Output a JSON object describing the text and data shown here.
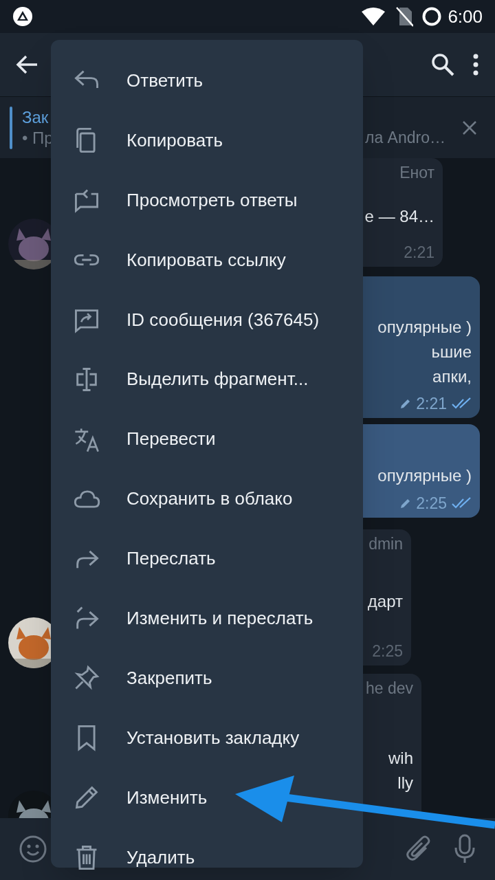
{
  "status_bar": {
    "time": "6:00"
  },
  "pinned": {
    "title": "Зак",
    "preview_start": "• Пр",
    "preview_end": "ла Andro…"
  },
  "messages": [
    {
      "kind": "incoming",
      "selected": false,
      "sender": "Енот",
      "lines": [
        "е — 84…"
      ],
      "time": "2:21",
      "edited": false,
      "read": false
    },
    {
      "kind": "outgoing",
      "selected": false,
      "lines": [
        "опулярные )",
        "ьшие",
        "апки,"
      ],
      "time": "2:21",
      "edited": true,
      "read": true
    },
    {
      "kind": "outgoing",
      "selected": true,
      "lines": [
        "опулярные )"
      ],
      "time": "2:25",
      "edited": true,
      "read": true
    },
    {
      "kind": "incoming",
      "selected": false,
      "sender": "dmin",
      "lines": [
        "дарт"
      ],
      "time": "2:25",
      "edited": false,
      "read": false
    },
    {
      "kind": "incoming",
      "selected": false,
      "sender": "he dev",
      "lines": [
        "wih",
        "lly"
      ]
    }
  ],
  "context_menu": [
    {
      "label": "Ответить"
    },
    {
      "label": "Копировать"
    },
    {
      "label": "Просмотреть ответы"
    },
    {
      "label": "Копировать ссылку"
    },
    {
      "label": "ID сообщения (367645)"
    },
    {
      "label": "Выделить фрагмент..."
    },
    {
      "label": "Перевести"
    },
    {
      "label": "Сохранить в облако"
    },
    {
      "label": "Переслать"
    },
    {
      "label": "Изменить и переслать"
    },
    {
      "label": "Закрепить"
    },
    {
      "label": "Установить закладку"
    },
    {
      "label": "Изменить"
    },
    {
      "label": "Удалить"
    }
  ]
}
